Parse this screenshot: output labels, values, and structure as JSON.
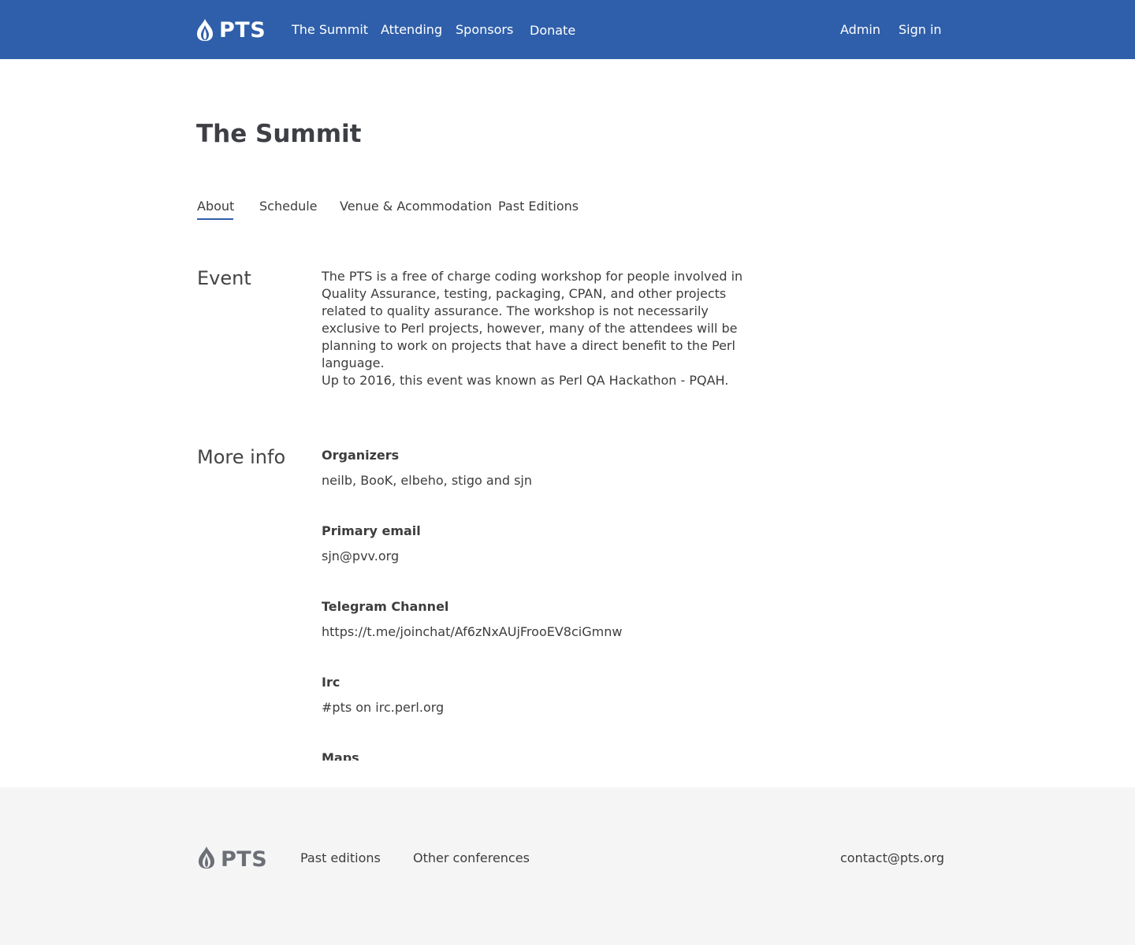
{
  "header": {
    "logo_text": "PTS",
    "logo_icon": "onion-icon",
    "nav": {
      "summit": "The Summit",
      "attending": "Attending",
      "sponsors": "Sponsors",
      "donate": "Donate"
    },
    "admin": "Admin",
    "sign_in": "Sign in",
    "color": "#2f5faa"
  },
  "main": {
    "title": "The Summit",
    "tabs": {
      "about": "About",
      "schedule": "Schedule",
      "venue": "Venue & Acommodation",
      "past": "Past Editions"
    },
    "active_tab": "About",
    "event": {
      "heading": "Event",
      "paragraph1": "The PTS is a free of charge coding workshop for people involved in Quality Assurance, testing, packaging, CPAN, and other projects related to quality assurance. The workshop is not necessarily exclusive to Perl projects, however, many of the attendees will be planning to work on projects that have a direct benefit to the Perl language.",
      "paragraph2": "Up to 2016, this event was known as Perl QA Hackathon - PQAH."
    },
    "more_info": {
      "heading": "More info",
      "organizers_label": "Organizers",
      "organizers_value": "neilb, BooK, elbeho, stigo and sjn",
      "email_label": "Primary email",
      "email_value": "sjn@pvv.org",
      "telegram_label": "Telegram Channel",
      "telegram_value": "https://t.me/joinchat/Af6zNxAUjFrooEV8ciGmnw",
      "irc_label": "Irc",
      "irc_value": "#pts on irc.perl.org",
      "maps_label": "Maps"
    }
  },
  "footer": {
    "logo_text": "PTS",
    "logo_icon": "onion-icon",
    "past_editions": "Past editions",
    "other_conferences": "Other conferences",
    "contact": "contact@pts.org"
  }
}
